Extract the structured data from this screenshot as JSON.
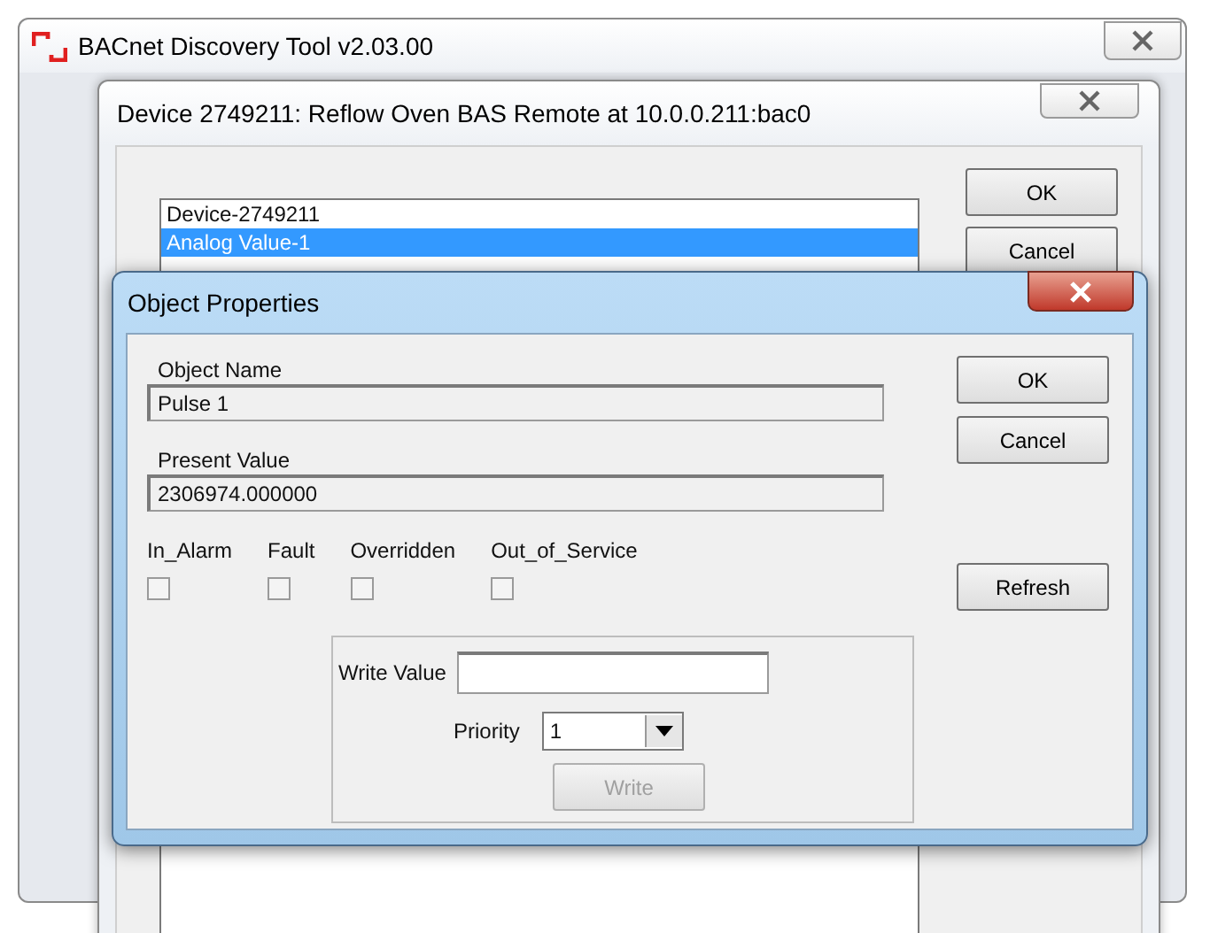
{
  "main_window": {
    "title": "BACnet Discovery Tool v2.03.00"
  },
  "device_window": {
    "title": "Device 2749211: Reflow Oven BAS Remote at 10.0.0.211:bac0",
    "objects": [
      {
        "label": "Device-2749211",
        "selected": false
      },
      {
        "label": "Analog Value-1",
        "selected": true
      }
    ],
    "buttons": [
      "OK",
      "Cancel"
    ]
  },
  "object_properties": {
    "title": "Object Properties",
    "fields": [
      {
        "label": "Object Name",
        "value": "Pulse 1"
      },
      {
        "label": "Present Value",
        "value": "2306974.000000"
      }
    ],
    "flags": [
      {
        "label": "In_Alarm",
        "checked": false
      },
      {
        "label": "Fault",
        "checked": false
      },
      {
        "label": "Overridden",
        "checked": false
      },
      {
        "label": "Out_of_Service",
        "checked": false
      }
    ],
    "buttons": [
      "OK",
      "Cancel",
      "Refresh"
    ],
    "write_group": {
      "write_value_label": "Write Value",
      "priority_label": "Priority",
      "priority": "1",
      "write_button": {
        "label": "Write",
        "disabled": true
      }
    }
  }
}
